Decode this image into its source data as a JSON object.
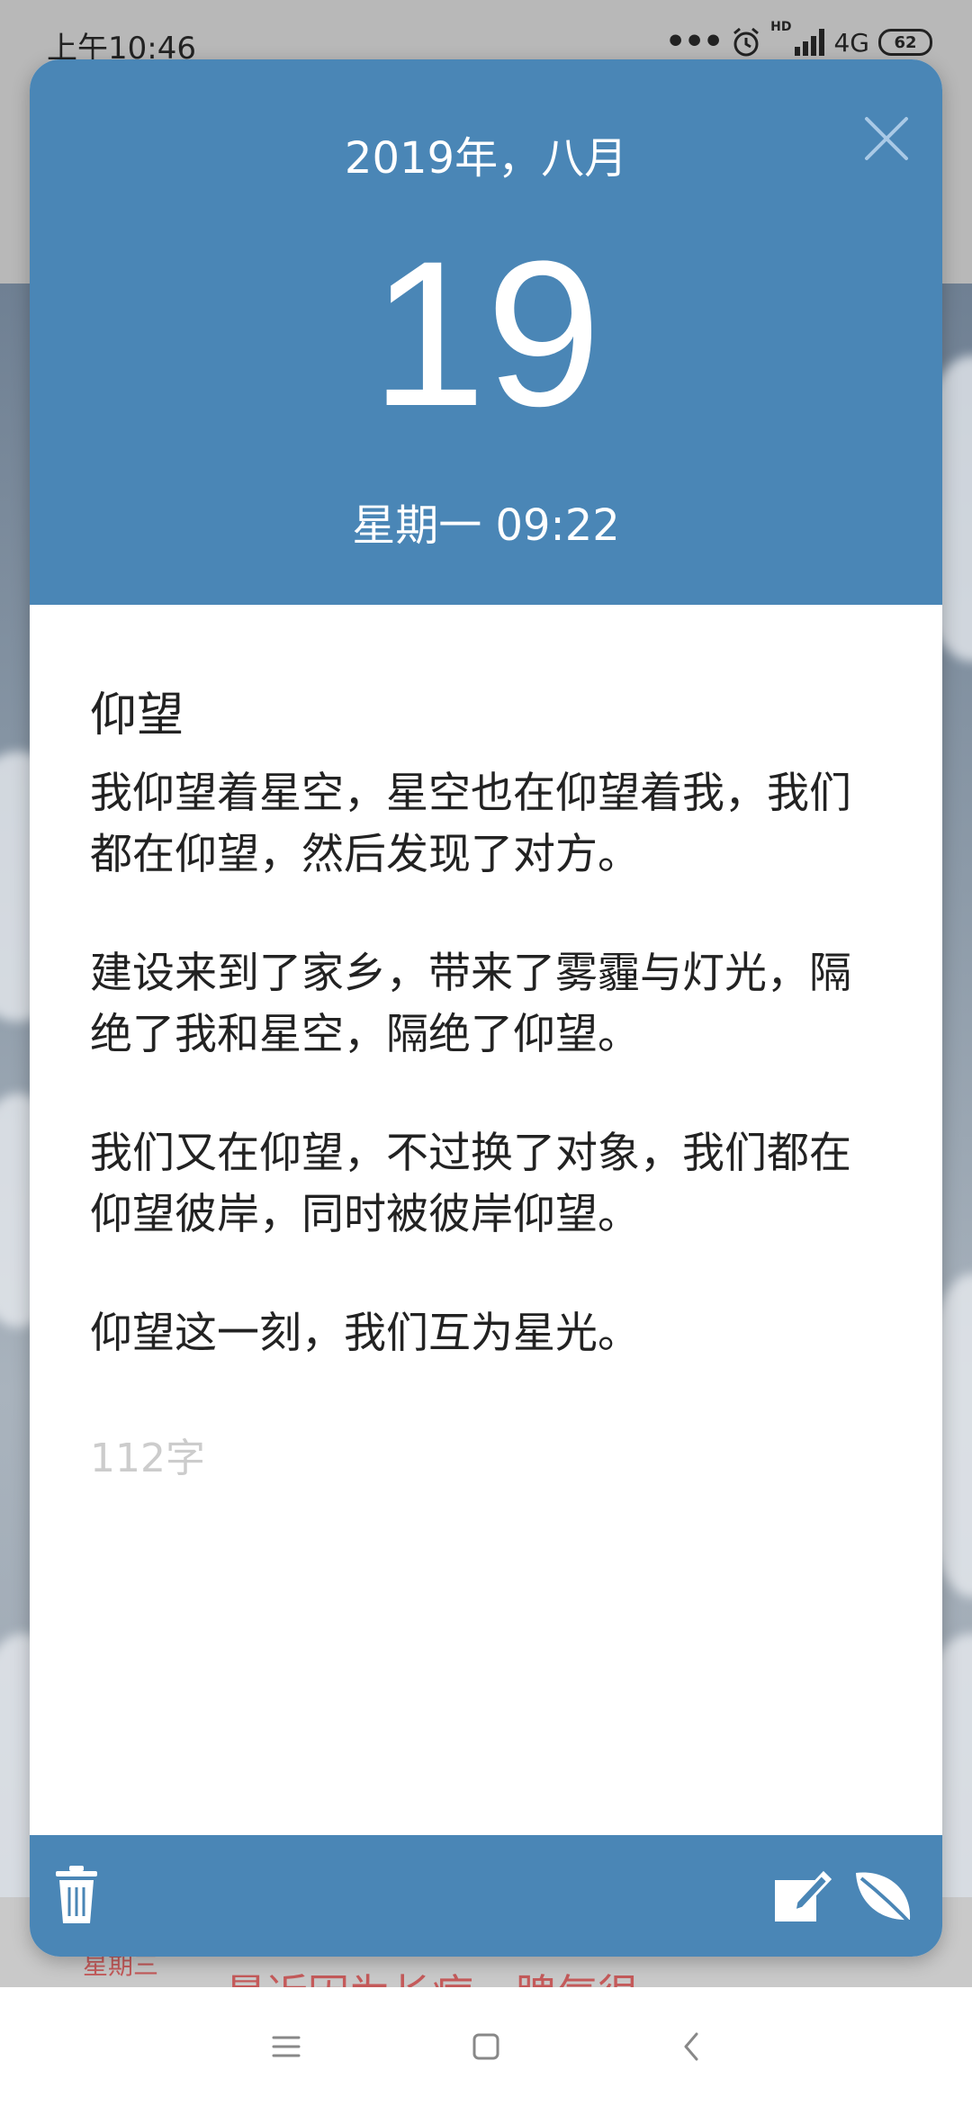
{
  "status_bar": {
    "time": "上午10:46",
    "dots": "•••",
    "hd": "HD",
    "network": "4G",
    "battery": "62"
  },
  "background_peek": {
    "weekday": "星期三",
    "text": "最近因为长痘，脾气很"
  },
  "card": {
    "header": {
      "month_year": "2019年，八月",
      "day": "19",
      "weekday_time": "星期一 09:22",
      "close_icon": "close-icon"
    },
    "note": {
      "title": "仰望",
      "paragraphs": [
        "我仰望着星空，星空也在仰望着我，我们都在仰望，然后发现了对方。",
        "建设来到了家乡，带来了雾霾与灯光，隔绝了我和星空，隔绝了仰望。",
        "我们又在仰望，不过换了对象，我们都在仰望彼岸，同时被彼岸仰望。",
        "仰望这一刻，我们互为星光。"
      ],
      "word_count": "112字"
    },
    "footer": {
      "delete_icon": "trash-icon",
      "edit_icon": "edit-icon",
      "leaf_icon": "leaf-icon"
    }
  },
  "colors": {
    "accent": "#4a86b6",
    "word_count": "#cccccc",
    "peek_text": "#c45a5a"
  },
  "nav_bar": {
    "menu_icon": "menu-icon",
    "home_icon": "home-icon",
    "back_icon": "back-icon"
  }
}
